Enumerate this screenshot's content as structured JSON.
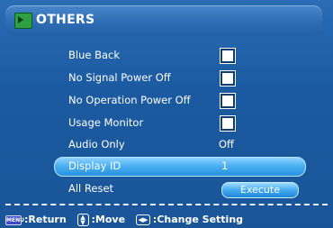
{
  "header": {
    "title": "OTHERS"
  },
  "items": [
    {
      "label": "Blue Back",
      "control": "checkbox",
      "checked": false
    },
    {
      "label": "No Signal Power Off",
      "control": "checkbox",
      "checked": false
    },
    {
      "label": "No Operation Power Off",
      "control": "checkbox",
      "checked": false
    },
    {
      "label": "Usage Monitor",
      "control": "checkbox",
      "checked": false
    },
    {
      "label": "Audio Only",
      "value": "Off"
    },
    {
      "label": "Display ID",
      "value": "1",
      "selected": true
    },
    {
      "label": "All Reset",
      "button": "Execute"
    }
  ],
  "footer": {
    "menu_icon_text": "MENU",
    "return_label": ":Return",
    "move_label": ":Move",
    "change_label": ":Change Setting"
  },
  "colors": {
    "background": "#1c5ea5",
    "highlight": "#4ab0f2",
    "header": "#2e6db4"
  }
}
